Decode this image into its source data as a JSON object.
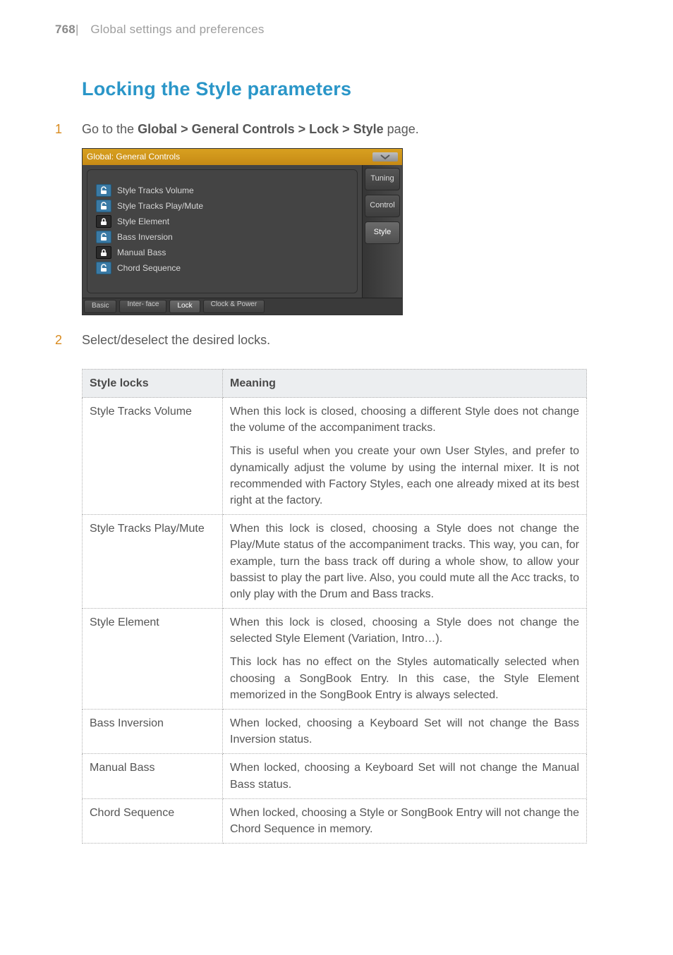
{
  "header": {
    "page_number": "768",
    "chapter_title": "Global settings and preferences"
  },
  "section_title": "Locking the Style parameters",
  "steps": {
    "s1": {
      "num": "1",
      "prefix": "Go to the ",
      "bold": "Global > General Controls > Lock > Style",
      "suffix": " page."
    },
    "s2": {
      "num": "2",
      "text": "Select/deselect the desired locks."
    }
  },
  "screenshot": {
    "title": "Global: General Controls",
    "locks": {
      "r0": {
        "label": "Style Tracks Volume",
        "state": "open"
      },
      "r1": {
        "label": "Style Tracks Play/Mute",
        "state": "open"
      },
      "r2": {
        "label": "Style Element",
        "state": "closed"
      },
      "r3": {
        "label": "Bass Inversion",
        "state": "open"
      },
      "r4": {
        "label": "Manual Bass",
        "state": "closed"
      },
      "r5": {
        "label": "Chord Sequence",
        "state": "open"
      }
    },
    "side_tabs": {
      "t0": "Tuning",
      "t1": "Control",
      "t2": "Style"
    },
    "foot_tabs": {
      "f0": "Basic",
      "f1": "Inter-\nface",
      "f2": "Lock",
      "f3": "Clock &\nPower"
    }
  },
  "table": {
    "head": {
      "c0": "Style locks",
      "c1": "Meaning"
    },
    "rows": {
      "r0": {
        "name": "Style Tracks Volume",
        "p1": "When this lock is closed, choosing a different Style does not change the volume of the accompaniment tracks.",
        "p2": "This is useful when you create your own User Styles, and prefer to dynamically adjust the volume by using the internal mixer. It is not recommended with Factory Styles, each one already mixed at its best right at the factory."
      },
      "r1": {
        "name": "Style Tracks Play/Mute",
        "p1": "When this lock is closed, choosing a Style does not change the Play/Mute status of the accompaniment tracks. This way, you can, for example, turn the bass track off during a whole show, to allow your bassist to play the part live. Also, you could mute all the Acc tracks, to only play with the Drum and Bass tracks."
      },
      "r2": {
        "name": "Style Element",
        "p1": "When this lock is closed, choosing a Style does not change the selected Style Element (Variation, Intro…).",
        "p2": "This lock has no effect on the Styles automatically selected when choosing a SongBook Entry. In this case, the Style Element memorized in the SongBook Entry is always selected."
      },
      "r3": {
        "name": "Bass Inversion",
        "p1": "When locked, choosing a Keyboard Set will not change the Bass Inversion status."
      },
      "r4": {
        "name": "Manual Bass",
        "p1": "When locked, choosing a Keyboard Set will not change the Manual Bass status."
      },
      "r5": {
        "name": "Chord Sequence",
        "p1": "When locked, choosing a Style or SongBook Entry will not change the Chord Sequence in memory."
      }
    }
  }
}
